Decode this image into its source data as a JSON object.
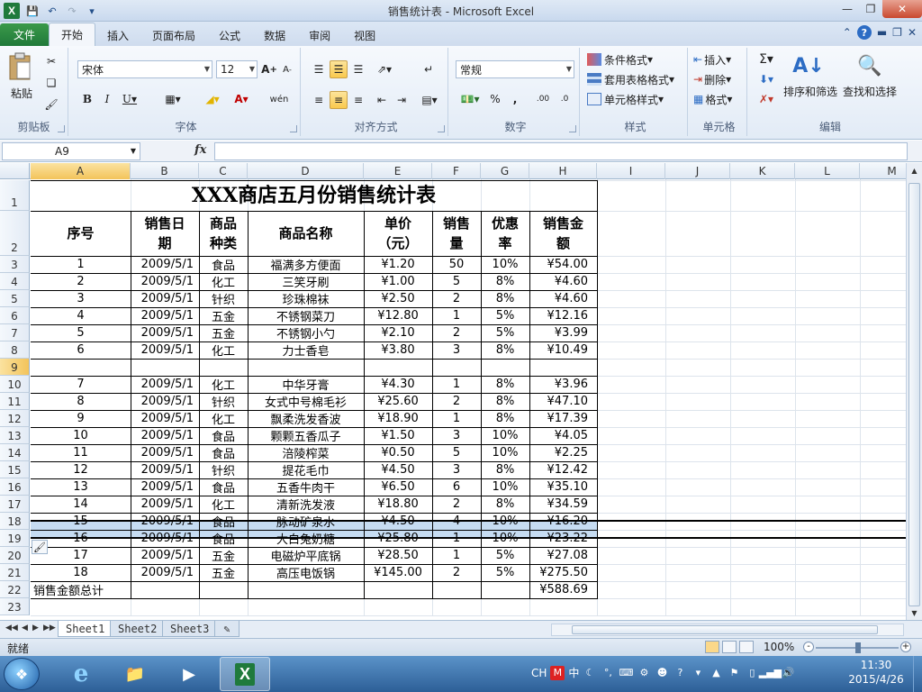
{
  "window": {
    "title": "销售统计表 - Microsoft Excel"
  },
  "tabs": {
    "file": "文件",
    "items": [
      "开始",
      "插入",
      "页面布局",
      "公式",
      "数据",
      "审阅",
      "视图"
    ]
  },
  "ribbon": {
    "clipboard": {
      "label": "剪贴板",
      "paste": "粘贴"
    },
    "font": {
      "label": "字体",
      "name": "宋体",
      "size": "12"
    },
    "alignment": {
      "label": "对齐方式"
    },
    "number": {
      "label": "数字",
      "format": "常规",
      "percent": "%",
      "comma": ","
    },
    "styles": {
      "label": "样式",
      "conditional": "条件格式",
      "table": "套用表格格式",
      "cell": "单元格样式"
    },
    "cells": {
      "label": "单元格",
      "insert": "插入",
      "delete": "删除",
      "format": "格式"
    },
    "editing": {
      "label": "编辑",
      "sort": "排序和筛选",
      "find": "查找和选择"
    }
  },
  "formula_bar": {
    "name_box": "A9",
    "fx": "fx",
    "value": ""
  },
  "grid": {
    "columns": [
      "A",
      "B",
      "C",
      "D",
      "E",
      "F",
      "G",
      "H",
      "I",
      "J",
      "K",
      "L",
      "M"
    ],
    "rows": [
      "1",
      "2",
      "3",
      "4",
      "5",
      "6",
      "7",
      "8",
      "9",
      "10",
      "11",
      "12",
      "13",
      "14",
      "15",
      "16",
      "17",
      "18",
      "19",
      "20",
      "21",
      "22",
      "23"
    ],
    "selected_row": "9",
    "selected_col": "A"
  },
  "sheet": {
    "title": "XXX商店五月份销售统计表",
    "headers": [
      "序号",
      "销售日\n期",
      "商品\n种类",
      "商品名称",
      "单价\n（元）",
      "销售\n量",
      "优惠\n率",
      "销售金\n额"
    ],
    "rows": [
      [
        "1",
        "2009/5/1",
        "食品",
        "福满多方便面",
        "¥1.20",
        "50",
        "10%",
        "¥54.00"
      ],
      [
        "2",
        "2009/5/1",
        "化工",
        "三笑牙刷",
        "¥1.00",
        "5",
        "8%",
        "¥4.60"
      ],
      [
        "3",
        "2009/5/1",
        "针织",
        "珍珠棉袜",
        "¥2.50",
        "2",
        "8%",
        "¥4.60"
      ],
      [
        "4",
        "2009/5/1",
        "五金",
        "不锈钢菜刀",
        "¥12.80",
        "1",
        "5%",
        "¥12.16"
      ],
      [
        "5",
        "2009/5/1",
        "五金",
        "不锈钢小勺",
        "¥2.10",
        "2",
        "5%",
        "¥3.99"
      ],
      [
        "6",
        "2009/5/1",
        "化工",
        "力士香皂",
        "¥3.80",
        "3",
        "8%",
        "¥10.49"
      ],
      [
        "",
        "",
        "",
        "",
        "",
        "",
        "",
        ""
      ],
      [
        "7",
        "2009/5/1",
        "化工",
        "中华牙膏",
        "¥4.30",
        "1",
        "8%",
        "¥3.96"
      ],
      [
        "8",
        "2009/5/1",
        "针织",
        "女式中号棉毛衫",
        "¥25.60",
        "2",
        "8%",
        "¥47.10"
      ],
      [
        "9",
        "2009/5/1",
        "化工",
        "飘柔洗发香波",
        "¥18.90",
        "1",
        "8%",
        "¥17.39"
      ],
      [
        "10",
        "2009/5/1",
        "食品",
        "颗颗五香瓜子",
        "¥1.50",
        "3",
        "10%",
        "¥4.05"
      ],
      [
        "11",
        "2009/5/1",
        "食品",
        "涪陵榨菜",
        "¥0.50",
        "5",
        "10%",
        "¥2.25"
      ],
      [
        "12",
        "2009/5/1",
        "针织",
        "提花毛巾",
        "¥4.50",
        "3",
        "8%",
        "¥12.42"
      ],
      [
        "13",
        "2009/5/1",
        "食品",
        "五香牛肉干",
        "¥6.50",
        "6",
        "10%",
        "¥35.10"
      ],
      [
        "14",
        "2009/5/1",
        "化工",
        "清新洗发液",
        "¥18.80",
        "2",
        "8%",
        "¥34.59"
      ],
      [
        "15",
        "2009/5/1",
        "食品",
        "脉动矿泉水",
        "¥4.50",
        "4",
        "10%",
        "¥16.20"
      ],
      [
        "16",
        "2009/5/1",
        "食品",
        "大白兔奶糖",
        "¥25.80",
        "1",
        "10%",
        "¥23.22"
      ],
      [
        "17",
        "2009/5/1",
        "五金",
        "电磁炉平底锅",
        "¥28.50",
        "1",
        "5%",
        "¥27.08"
      ],
      [
        "18",
        "2009/5/1",
        "五金",
        "高压电饭锅",
        "¥145.00",
        "2",
        "5%",
        "¥275.50"
      ]
    ],
    "total_label": "销售金额总计",
    "total_value": "¥588.69"
  },
  "sheet_tabs": [
    "Sheet1",
    "Sheet2",
    "Sheet3"
  ],
  "status": {
    "text": "就绪",
    "zoom": "100%"
  },
  "taskbar": {
    "lang": "CH",
    "ime": "中",
    "time": "11:30",
    "date": "2015/4/26"
  }
}
